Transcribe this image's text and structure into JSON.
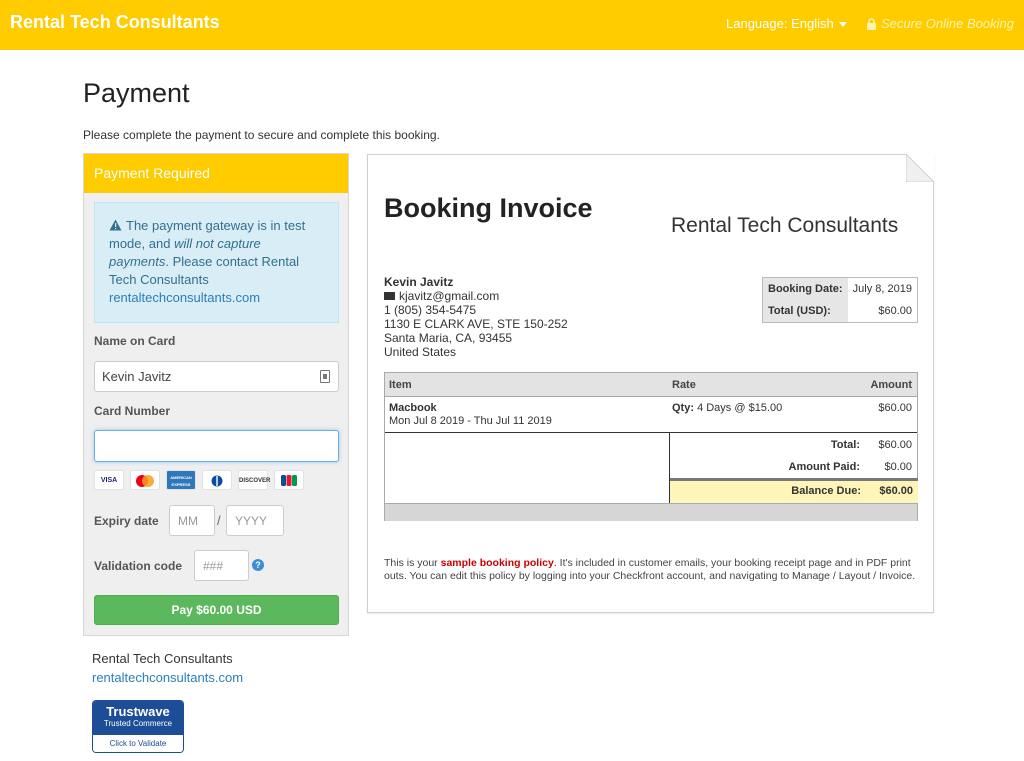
{
  "header": {
    "brand": "Rental Tech Consultants",
    "language": "Language: English",
    "secure": "Secure Online Booking"
  },
  "page": {
    "title": "Payment",
    "description": "Please complete the payment to secure and complete this booking."
  },
  "payment": {
    "panel_title": "Payment Required",
    "alert": {
      "icon": "warning-icon",
      "text_1": "The payment gateway is in test mode, and",
      "text_em": "will not capture payments",
      "text_2": ". Please contact Rental Tech Consultants",
      "link": "rentaltechconsultants.com"
    },
    "name_label": "Name on Card",
    "name_value": "Kevin Javitz",
    "card_label": "Card Number",
    "card_value": "",
    "card_brands": [
      "VISA",
      "MasterCard",
      "AMERICAN EXPRESS",
      "Diners",
      "DISCOVER",
      "JCB"
    ],
    "expiry_label": "Expiry date",
    "month_placeholder": "MM",
    "separator": "/",
    "year_placeholder": "YYYY",
    "validation_label": "Validation code",
    "cvv_placeholder": "###",
    "pay_button": "Pay $60.00 USD"
  },
  "footer": {
    "company": "Rental Tech Consultants",
    "link": "rentaltechconsultants.com",
    "trustwave": {
      "name": "Trustwave",
      "subtitle": "Trusted Commerce",
      "action": "Click to Validate"
    }
  },
  "invoice": {
    "title": "Booking Invoice",
    "company": "Rental Tech Consultants",
    "customer": {
      "name": "Kevin Javitz",
      "email": "kjavitz@gmail.com",
      "phone": "1 (805) 354-5475",
      "address1": "1130 E CLARK AVE, STE 150-252",
      "address2": "Santa Maria, CA, 93455",
      "country": "United States"
    },
    "meta": {
      "date_label": "Booking Date:",
      "date_value": "July 8, 2019",
      "total_label": "Total (USD):",
      "total_value": "$60.00"
    },
    "columns": {
      "item": "Item",
      "rate": "Rate",
      "amount": "Amount"
    },
    "line": {
      "name": "Macbook",
      "dates": "Mon Jul 8 2019 - Thu Jul 11 2019",
      "qty_label": "Qty:",
      "qty_value": "4 Days @ $15.00",
      "amount": "$60.00"
    },
    "totals": {
      "total_label": "Total:",
      "total_value": "$60.00",
      "paid_label": "Amount Paid:",
      "paid_value": "$0.00",
      "due_label": "Balance Due:",
      "due_value": "$60.00"
    },
    "policy": {
      "before": "This is your ",
      "highlight": "sample booking policy",
      "after": ". It's included in customer emails, your booking receipt page and in PDF print outs. You can edit this policy by logging into your Checkfront account, and navigating to Manage / Layout / Invoice."
    }
  }
}
